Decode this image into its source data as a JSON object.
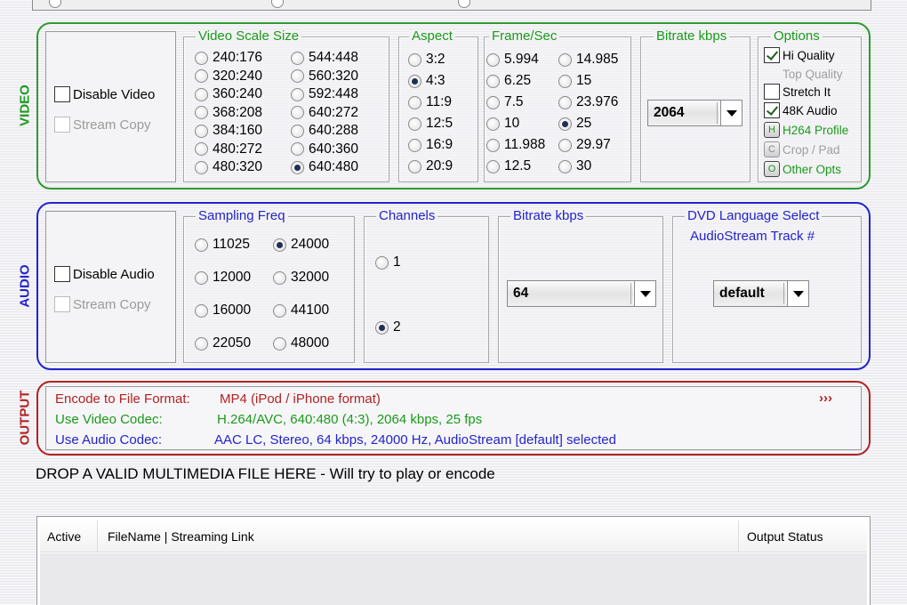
{
  "video": {
    "section_label": "VIDEO",
    "disable_video": {
      "label": "Disable Video",
      "checked": false
    },
    "stream_copy": {
      "label": "Stream Copy",
      "checked": false,
      "disabled": true
    },
    "scale": {
      "legend": "Video Scale Size",
      "options": [
        "240:176",
        "320:240",
        "360:240",
        "368:208",
        "384:160",
        "480:272",
        "480:320",
        "544:448",
        "560:320",
        "592:448",
        "640:272",
        "640:288",
        "640:360",
        "640:480"
      ],
      "selected": "640:480"
    },
    "aspect": {
      "legend": "Aspect",
      "options": [
        "3:2",
        "4:3",
        "11:9",
        "12:5",
        "16:9",
        "20:9"
      ],
      "selected": "4:3"
    },
    "framerate": {
      "legend": "Frame/Sec",
      "options": [
        "5.994",
        "6.25",
        "7.5",
        "10",
        "11.988",
        "12.5",
        "14.985",
        "15",
        "23.976",
        "25",
        "29.97",
        "30"
      ],
      "selected": "25"
    },
    "bitrate": {
      "legend": "Bitrate  kbps",
      "value": "2064"
    },
    "options": {
      "legend": "Options",
      "hi_quality": "Hi Quality",
      "top_quality": "Top Quality",
      "stretch_it": "Stretch It",
      "audio_48k": "48K Audio",
      "h264_btn": "H",
      "h264_label": "H264 Profile",
      "crop_btn": "C",
      "crop_label": "Crop / Pad",
      "other_btn": "O",
      "other_label": "Other Opts"
    }
  },
  "audio": {
    "section_label": "AUDIO",
    "disable_audio": {
      "label": "Disable Audio",
      "checked": false
    },
    "stream_copy": {
      "label": "Stream Copy",
      "checked": false,
      "disabled": true
    },
    "sampling": {
      "legend": "Sampling Freq",
      "options": [
        "11025",
        "12000",
        "16000",
        "22050",
        "24000",
        "32000",
        "44100",
        "48000"
      ],
      "selected": "24000"
    },
    "channels": {
      "legend": "Channels",
      "options": [
        "1",
        "2"
      ],
      "selected": "2"
    },
    "bitrate": {
      "legend": "Bitrate  kbps",
      "value": "64"
    },
    "dvd": {
      "legend": "DVD Language Select",
      "subtitle": "AudioStream  Track #",
      "value": "default"
    }
  },
  "output": {
    "section_label": "OUTPUT",
    "format_label": "Encode to File Format:",
    "format_value": "MP4 (iPod / iPhone format)",
    "more": "›››",
    "video_label": "Use Video Codec:",
    "video_value": "H.264/AVC,  640:480 (4:3),  2064 kbps,  25 fps",
    "audio_label": "Use Audio Codec:",
    "audio_value": "AAC LC,  Stereo,  64 kbps,  24000 Hz,  AudioStream [default] selected"
  },
  "drop_text": "DROP A VALID MULTIMEDIA FILE HERE - Will try to play or encode",
  "filelist": {
    "col_active": "Active",
    "col_filename": "FileName  |  Streaming Link",
    "col_status": "Output Status"
  },
  "colors": {
    "video": "#2e9a2e",
    "audio": "#2323cc",
    "output": "#b32222"
  }
}
